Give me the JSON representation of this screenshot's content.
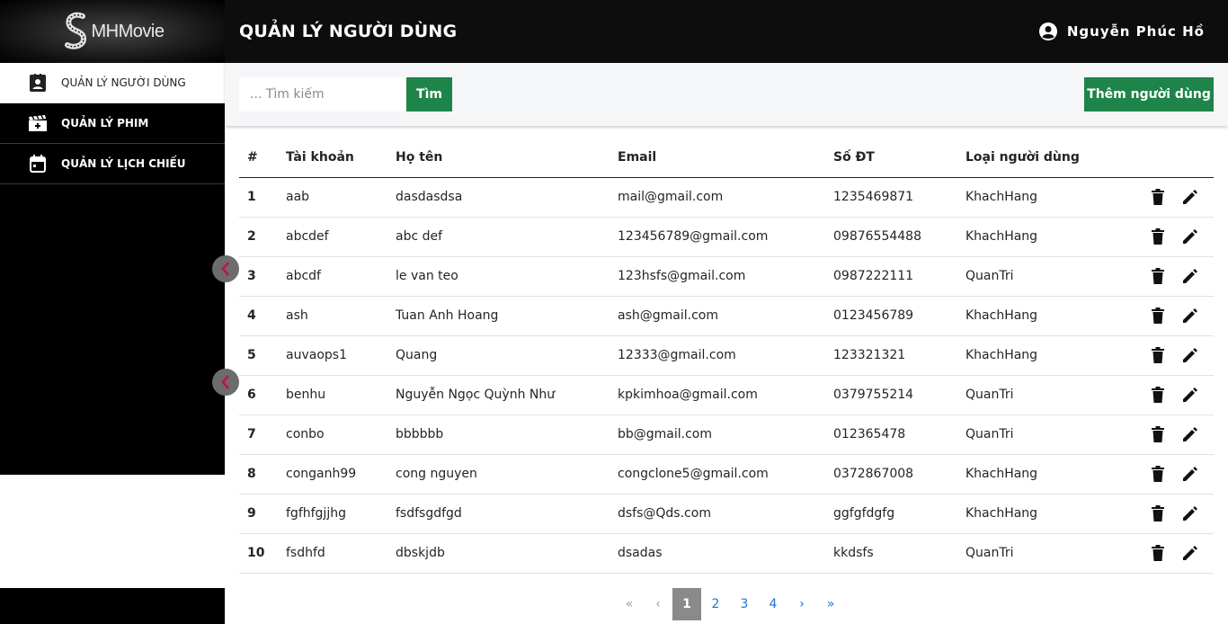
{
  "brand": {
    "logo_text": "MHMovie",
    "logo_mark": "S"
  },
  "sidebar": {
    "items": [
      {
        "label": "QUẢN LÝ NGƯỜI DÙNG",
        "icon": "user-badge-icon",
        "active": true
      },
      {
        "label": "QUẢN LÝ PHIM",
        "icon": "movie-icon",
        "active": false
      },
      {
        "label": "QUẢN LÝ LỊCH CHIẾU",
        "icon": "calendar-icon",
        "active": false
      }
    ]
  },
  "header": {
    "title": "QUẢN LÝ NGƯỜI DÙNG",
    "user_name": "Nguyễn Phúc Hồ"
  },
  "toolbar": {
    "search_placeholder": "... Tìm kiếm",
    "search_label": "Tìm",
    "add_label": "Thêm người dùng"
  },
  "table": {
    "headers": [
      "#",
      "Tài khoản",
      "Họ tên",
      "Email",
      "Số ĐT",
      "Loại người dùng"
    ],
    "rows": [
      [
        "1",
        "aab",
        "dasdasdsa",
        "mail@gmail.com",
        "1235469871",
        "KhachHang"
      ],
      [
        "2",
        "abcdef",
        "abc def",
        "123456789@gmail.com",
        "09876554488",
        "KhachHang"
      ],
      [
        "3",
        "abcdf",
        "le van teo",
        "123hsfs@gmail.com",
        "0987222111",
        "QuanTri"
      ],
      [
        "4",
        "ash",
        "Tuan Anh Hoang",
        "ash@gmail.com",
        "0123456789",
        "KhachHang"
      ],
      [
        "5",
        "auvaops1",
        "Quang",
        "12333@gmail.com",
        "123321321",
        "KhachHang"
      ],
      [
        "6",
        "benhu",
        "Nguyễn Ngọc Quỳnh Như",
        "kpkimhoa@gmail.com",
        "0379755214",
        "QuanTri"
      ],
      [
        "7",
        "conbo",
        "bbbbbb",
        "bb@gmail.com",
        "012365478",
        "QuanTri"
      ],
      [
        "8",
        "conganh99",
        "cong nguyen",
        "congclone5@gmail.com",
        "0372867008",
        "KhachHang"
      ],
      [
        "9",
        "fgfhfgjjhg",
        "fsdfsgdfgd",
        "dsfs@Qds.com",
        "ggfgfdgfg",
        "KhachHang"
      ],
      [
        "10",
        "fsdhfd",
        "dbskjdb",
        "dsadas",
        "kkdsfs",
        "QuanTri"
      ]
    ]
  },
  "pagination": {
    "first": "«",
    "prev": "‹",
    "next": "›",
    "last": "»",
    "pages": [
      "1",
      "2",
      "3",
      "4"
    ],
    "current": "1"
  },
  "colors": {
    "accent": "#1e8449",
    "header_bg": "#0d0d0d",
    "sidebar_bg": "#000000",
    "chevron": "#c0143c"
  }
}
